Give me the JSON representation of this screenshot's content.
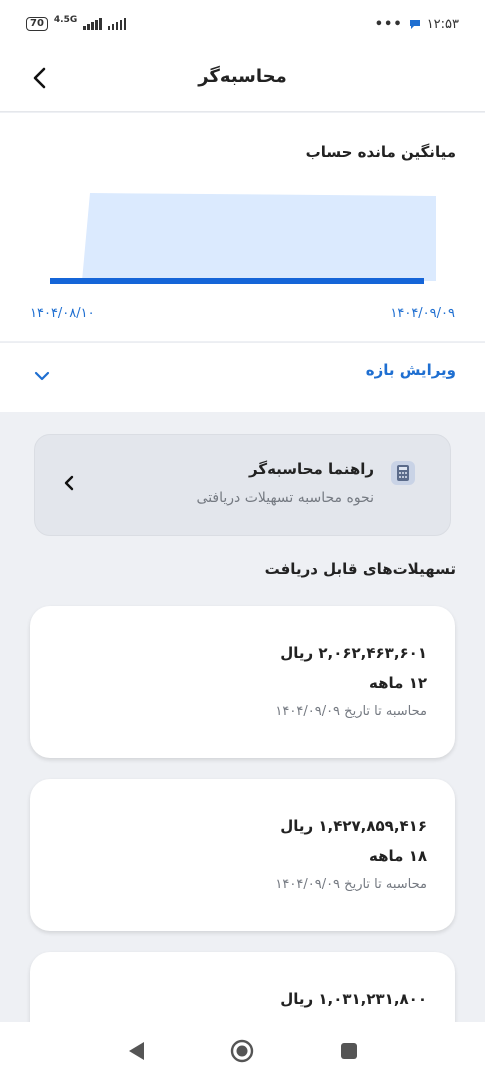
{
  "status_bar": {
    "battery": "70",
    "network": "4.5G",
    "dots": "•••",
    "time": "۱۲:۵۳"
  },
  "header": {
    "title": "محاسبه‌گر",
    "back_icon": "chevron-left-icon"
  },
  "chart": {
    "title": "میانگین مانده حساب",
    "date_start": "۱۴۰۴/۰۸/۱۰",
    "date_end": "۱۴۰۴/۰۹/۰۹",
    "fill_color": "#dbeafe",
    "line_color": "#1565d8"
  },
  "edit_range": {
    "label": "ویرایش بازه",
    "icon": "chevron-down-icon"
  },
  "guide": {
    "title": "راهنما محاسبه‌گر",
    "subtitle": "نحوه محاسبه تسهیلات دریافتی",
    "icon": "calculator-icon"
  },
  "section_title": "تسهیلات‌های قابل دریافت",
  "loans": [
    {
      "amount": "۲,۰۶۲,۴۶۳,۶۰۱ ریال",
      "term": "۱۲ ماهه",
      "calc_date": "محاسبه تا تاریخ ۱۴۰۴/۰۹/۰۹"
    },
    {
      "amount": "۱,۴۲۷,۸۵۹,۴۱۶ ریال",
      "term": "۱۸ ماهه",
      "calc_date": "محاسبه تا تاریخ ۱۴۰۴/۰۹/۰۹"
    },
    {
      "amount": "۱,۰۳۱,۲۳۱,۸۰۰ ریال",
      "term": "",
      "calc_date": ""
    }
  ],
  "accent_color": "#1f6fd1"
}
